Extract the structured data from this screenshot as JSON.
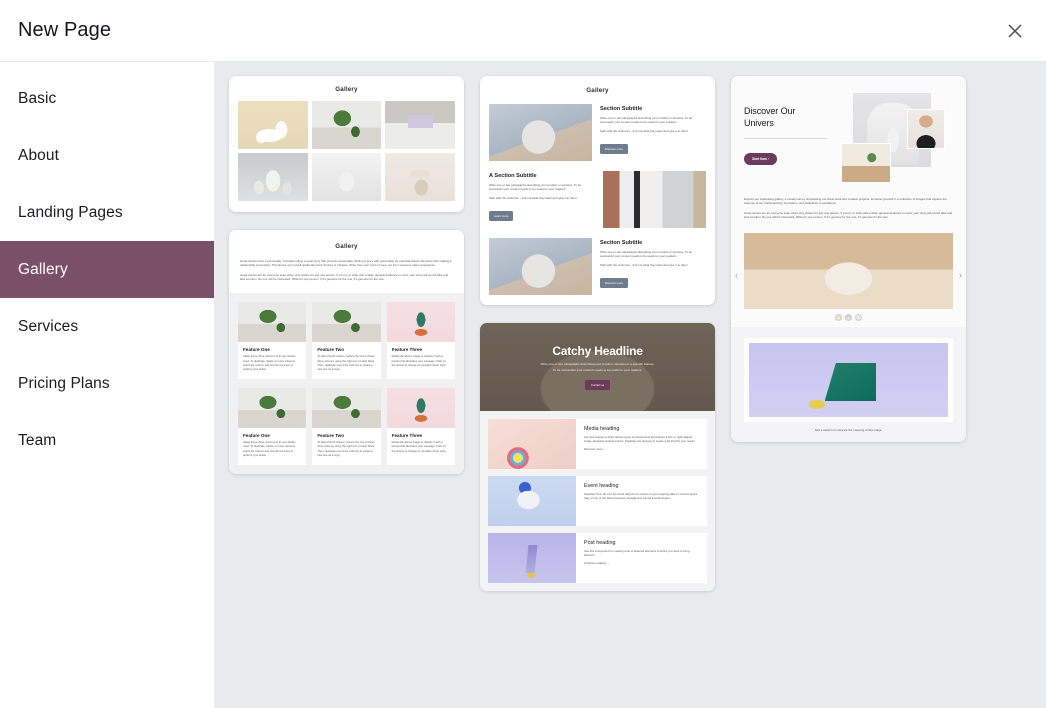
{
  "header": {
    "title": "New Page",
    "close_icon": "close-icon"
  },
  "sidebar": {
    "items": [
      {
        "label": "Basic",
        "active": false
      },
      {
        "label": "About",
        "active": false
      },
      {
        "label": "Landing Pages",
        "active": false
      },
      {
        "label": "Gallery",
        "active": true
      },
      {
        "label": "Services",
        "active": false
      },
      {
        "label": "Pricing Plans",
        "active": false
      },
      {
        "label": "Team",
        "active": false
      }
    ],
    "active_label": "Gallery",
    "active_color": "#7a5069"
  },
  "colors": {
    "accent": "#7a5069",
    "cta_purple": "#6c3a5c",
    "button_slate": "#6e7c8c",
    "content_bg": "#e8eaee",
    "card_bg": "#ffffff"
  },
  "templates": {
    "gallery_grid": {
      "title": "Gallery",
      "images": [
        "beige-vases-image",
        "potted-plant-image",
        "shelf-decor-image",
        "grey-vases-image",
        "white-speaker-image",
        "stone-stack-image"
      ]
    },
    "gallery_features": {
      "title": "Gallery",
      "paragraph_1": "Great stories have a personality. Consider telling a great story that provides personality. Writing a story with personality for potential clients will assist with making a relationship connection. This shows up in small quirks like word choices or phrases. Write from your point of view, not from someone else's experience.",
      "paragraph_2": "Great stories are for everyone even when only written for just one person. If you try to write with a wide, general audience in mind, your story will sound fake and lack emotion. No one will be interested. Write for one person. If it's genuine for the one, it's genuine for the rest.",
      "features": [
        {
          "heading": "Feature One",
          "body": "Adapt these three columns to fit your design need. To duplicate, delete or move columns, select the column and use the top icons to perform your action.",
          "image": "hanging-plant-image"
        },
        {
          "heading": "Feature Two",
          "body": "To add a fourth column, reduce the size of these three columns using the right icon of each block. Then, duplicate one of the columns to create a new one as a copy.",
          "image": "potted-fern-image"
        },
        {
          "heading": "Feature Three",
          "body": "Delete the above image or replace it with a picture that illustrates your message. Click on the picture to change its rounded corner style.",
          "image": "cactus-image"
        }
      ]
    },
    "gallery_sections": {
      "title": "Gallery",
      "sections": [
        {
          "heading": "Section Subtitle",
          "body_1": "Write one or two paragraphs describing your product or services. To be successful your content needs to be useful to your readers.",
          "body_2": "Start with the customer - find out what they want and give it to them.",
          "button": "Discover more",
          "image": "sphere-image",
          "image_side": "left"
        },
        {
          "heading": "A Section Subtitle",
          "body_1": "Write one or two paragraphs describing your product or services. To be successful your content needs to be useful to your readers.",
          "body_2": "Start with the customer - find out what they want and give it to them.",
          "button": "Learn more",
          "image": "basket-shelf-image",
          "image_side": "right"
        },
        {
          "heading": "Section Subtitle",
          "body_1": "Write one or two paragraphs describing your product or services. To be successful your content needs to be useful to your readers.",
          "body_2": "Start with the customer - find out what they want and give it to them.",
          "button": "Discover more",
          "image": "sphere-image",
          "image_side": "left"
        }
      ]
    },
    "catchy_headline": {
      "hero": {
        "headline": "Catchy Headline",
        "sub_1": "Write one or two paragraphs describing your product, services or a specific feature.",
        "sub_2": "To be successful your content needs to be useful to your readers.",
        "button": "Contact us",
        "image": "arch-room-image"
      },
      "rows": [
        {
          "heading": "Media heading",
          "body": "Use this snippet to build various types of components that feature a left- or right-aligned image alongside textual content. Duplicate the element to create a list that fits your needs.",
          "link": "Discover more  →",
          "image": "beachball-image"
        },
        {
          "heading": "Event heading",
          "body": "Speakers from all over the world will join our experts to give inspiring talks on various topics. Stay on top of the latest business management trends & technologies.",
          "link": "",
          "image": "blue-box-image"
        },
        {
          "heading": "Post heading",
          "body": "Use this component for creating a list of featured elements to which you want to bring attention.",
          "link": "Continue reading  →",
          "image": "purple-cone-image"
        }
      ]
    },
    "discover": {
      "headline": "Discover Our\nUnivers",
      "button": "Start Now  ›",
      "paragraph_1": "Explore our captivating gallery, a visual journey showcasing our finest work and creative projects. Immerse yourself in a collection of images that capture the essence of our craftsmanship, innovation, and dedication to excellence.",
      "paragraph_2": "Great stories are for everyone even when only written for just one person. If you try to write with a wide, general audience in mind, your story will sound fake and lack emotion. No one will be interested. Write for one person. If it's genuine for the one, it's genuine for the rest.",
      "carousel": {
        "prev_icon": "chevron-left-icon",
        "next_icon": "chevron-right-icon",
        "main_image": "white-cup-image",
        "thumbnails": [
          "thumb-beige-image",
          "thumb-grey-image",
          "thumb-white-image"
        ]
      },
      "figure": {
        "image": "green-wedge-image",
        "caption": "Add a caption to enhance the meaning of this image."
      },
      "hero_images": [
        "grey-panel-image",
        "white-speaker-image",
        "portrait-image",
        "bedroom-image"
      ]
    }
  }
}
